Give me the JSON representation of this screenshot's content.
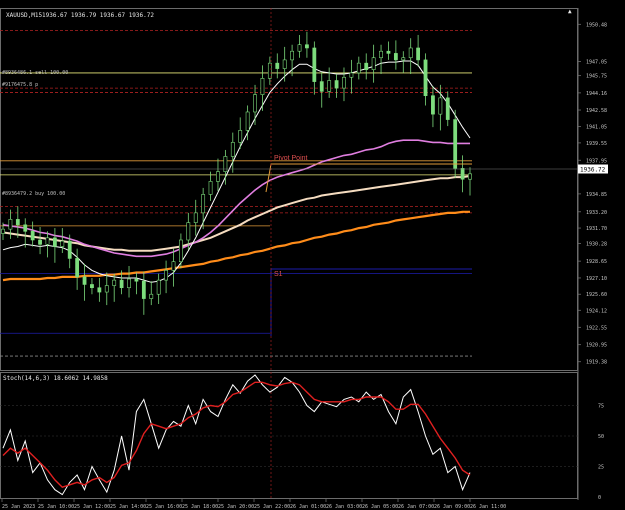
{
  "window": {
    "symbol_label": "XAUUSD,M15"
  },
  "header": {
    "ohlc": "1936.67 1936.79 1936.67 1936.72"
  },
  "levels": {
    "pivot_label": "Pivot Point",
    "s1_label": "S1",
    "order_lines": [
      "#8936486.1 sell 100.00",
      "#9176475.8 p",
      "#8936479.2 buy 100.00"
    ],
    "current_price_badge": "1936.72"
  },
  "indicator": {
    "label": "Stoch(14,6,3) 18.6062 14.9858"
  },
  "chart_data": [
    {
      "type": "line",
      "series_kind": "candlestick",
      "ylim": [
        1918.8,
        1951.8
      ],
      "y_ticks": [
        "1950.48",
        "1947.05",
        "1945.75",
        "1944.16",
        "1942.58",
        "1941.05",
        "1939.55",
        "1937.95",
        "1936.72",
        "1934.85",
        "1933.20",
        "1931.70",
        "1930.28",
        "1928.65",
        "1927.10",
        "1925.60",
        "1924.12",
        "1922.55",
        "1920.95",
        "1919.38"
      ],
      "x_ticks": [
        "25 Jan 2023",
        "25 Jan 10:00",
        "25 Jan 12:00",
        "25 Jan 14:00",
        "25 Jan 16:00",
        "25 Jan 18:00",
        "25 Jan 20:00",
        "25 Jan 22:00",
        "26 Jan 01:00",
        "26 Jan 03:00",
        "26 Jan 05:00",
        "26 Jan 07:00",
        "26 Jan 09:00",
        "26 Jan 11:00"
      ],
      "price_close": [
        1931.6,
        1932.5,
        1932.0,
        1931.4,
        1930.6,
        1930.2,
        1930.8,
        1930.0,
        1930.5,
        1928.9,
        1927.2,
        1926.5,
        1926.2,
        1925.8,
        1926.4,
        1926.9,
        1926.2,
        1927.0,
        1926.8,
        1925.2,
        1925.6,
        1926.9,
        1927.8,
        1928.6,
        1930.6,
        1932.2,
        1933.1,
        1934.8,
        1936.0,
        1936.9,
        1938.3,
        1939.6,
        1940.7,
        1942.4,
        1944.0,
        1945.5,
        1946.9,
        1946.4,
        1947.2,
        1948.0,
        1948.6,
        1948.3,
        1945.2,
        1944.3,
        1945.3,
        1944.6,
        1945.6,
        1946.0,
        1946.9,
        1946.3,
        1947.4,
        1948.0,
        1947.8,
        1947.2,
        1947.4,
        1948.3,
        1947.2,
        1943.9,
        1942.2,
        1943.7,
        1941.7,
        1937.2,
        1936.2,
        1936.7
      ],
      "ema_fast": [
        1929.7,
        1929.9,
        1930.0,
        1930.2,
        1930.1,
        1930.0,
        1930.1,
        1930.0,
        1929.9,
        1929.6,
        1929.0,
        1928.3,
        1927.8,
        1927.5,
        1927.3,
        1927.2,
        1927.1,
        1927.1,
        1927.1,
        1926.9,
        1926.7,
        1926.8,
        1927.1,
        1927.6,
        1928.5,
        1929.6,
        1930.8,
        1932.2,
        1933.6,
        1935.0,
        1936.4,
        1937.8,
        1939.2,
        1940.5,
        1941.8,
        1943.0,
        1944.2,
        1945.0,
        1945.7,
        1946.3,
        1946.8,
        1946.8,
        1946.4,
        1946.1,
        1946.0,
        1945.9,
        1945.9,
        1946.0,
        1946.2,
        1946.4,
        1946.6,
        1946.9,
        1947.0,
        1947.0,
        1947.1,
        1947.1,
        1946.7,
        1945.7,
        1944.7,
        1944.1,
        1943.2,
        1942.1,
        1941.0,
        1940.0
      ],
      "ema_mid": [
        1932.0,
        1931.9,
        1931.8,
        1931.7,
        1931.5,
        1931.3,
        1931.2,
        1931.0,
        1930.9,
        1930.7,
        1930.5,
        1930.2,
        1930.0,
        1929.8,
        1929.6,
        1929.4,
        1929.3,
        1929.2,
        1929.1,
        1929.1,
        1929.1,
        1929.2,
        1929.3,
        1929.5,
        1929.8,
        1930.1,
        1930.4,
        1930.8,
        1931.3,
        1931.9,
        1932.6,
        1933.3,
        1934.0,
        1934.6,
        1935.2,
        1935.7,
        1936.1,
        1936.4,
        1936.6,
        1936.8,
        1937.0,
        1937.2,
        1937.5,
        1937.8,
        1938.0,
        1938.2,
        1938.4,
        1938.5,
        1938.7,
        1938.9,
        1939.0,
        1939.2,
        1939.5,
        1939.7,
        1939.8,
        1939.8,
        1939.8,
        1939.7,
        1939.6,
        1939.6,
        1939.5,
        1939.5,
        1939.5,
        1939.5
      ],
      "ema_slow": [
        1931.3,
        1931.2,
        1931.1,
        1931.0,
        1930.9,
        1930.8,
        1930.7,
        1930.6,
        1930.5,
        1930.4,
        1930.3,
        1930.1,
        1930.0,
        1929.9,
        1929.8,
        1929.7,
        1929.7,
        1929.6,
        1929.6,
        1929.6,
        1929.6,
        1929.7,
        1929.8,
        1929.9,
        1930.0,
        1930.2,
        1930.4,
        1930.6,
        1930.8,
        1931.1,
        1931.4,
        1931.7,
        1932.0,
        1932.4,
        1932.7,
        1933.0,
        1933.3,
        1933.6,
        1933.8,
        1934.0,
        1934.2,
        1934.4,
        1934.5,
        1934.7,
        1934.8,
        1934.9,
        1935.0,
        1935.1,
        1935.2,
        1935.3,
        1935.4,
        1935.5,
        1935.6,
        1935.7,
        1935.8,
        1935.9,
        1936.0,
        1936.1,
        1936.2,
        1936.3,
        1936.3,
        1936.4,
        1936.4,
        1936.5
      ],
      "ema_long": [
        1926.9,
        1927.0,
        1927.0,
        1927.0,
        1927.0,
        1927.0,
        1927.1,
        1927.1,
        1927.2,
        1927.2,
        1927.2,
        1927.3,
        1927.3,
        1927.3,
        1927.4,
        1927.4,
        1927.5,
        1927.5,
        1927.6,
        1927.6,
        1927.7,
        1927.8,
        1927.9,
        1928.0,
        1928.1,
        1928.2,
        1928.3,
        1928.4,
        1928.6,
        1928.7,
        1928.9,
        1929.0,
        1929.2,
        1929.3,
        1929.5,
        1929.6,
        1929.8,
        1930.0,
        1930.1,
        1930.3,
        1930.4,
        1930.6,
        1930.8,
        1930.9,
        1931.1,
        1931.2,
        1931.4,
        1931.5,
        1931.7,
        1931.8,
        1932.0,
        1932.1,
        1932.2,
        1932.4,
        1932.5,
        1932.6,
        1932.7,
        1932.8,
        1932.9,
        1933.0,
        1933.1,
        1933.1,
        1933.2,
        1933.2
      ],
      "horizontal_levels": [
        {
          "price": 1949.9,
          "color": "#b22222"
        },
        {
          "price": 1946.0,
          "color": "#e8e87a"
        },
        {
          "price": 1944.6,
          "color": "#b22222"
        },
        {
          "price": 1944.2,
          "color": "#b22222"
        },
        {
          "price": 1936.6,
          "color": "#e8e87a"
        },
        {
          "price": 1937.9,
          "color": "#e09a3a"
        },
        {
          "price": 1933.7,
          "color": "#b22222"
        },
        {
          "price": 1933.1,
          "color": "#b22222"
        },
        {
          "price": 1931.9,
          "color": "#e09a3a"
        },
        {
          "price": 1927.5,
          "color": "#1c1caa"
        },
        {
          "price": 1922.0,
          "color": "#1c1caa"
        },
        {
          "price": 1919.9,
          "color": "#888888"
        }
      ],
      "colors": {
        "candle": "#7ddc7d",
        "ema_fast": "#ffffff",
        "ema_mid": "#e07ee0",
        "ema_slow": "#f5dcc0",
        "ema_long": "#ff8c1a",
        "price_line": "#c8c8c8"
      }
    },
    {
      "type": "line",
      "title": "Stoch(14,6,3) 18.6062 14.9858",
      "ylim": [
        0,
        100
      ],
      "y_ticks": [
        "75",
        "50",
        "25",
        "0"
      ],
      "series": [
        {
          "name": "main",
          "values": [
            40,
            55,
            30,
            46,
            20,
            28,
            14,
            6,
            2,
            12,
            18,
            6,
            25,
            14,
            4,
            22,
            50,
            22,
            70,
            80,
            60,
            40,
            55,
            62,
            58,
            75,
            60,
            80,
            70,
            66,
            80,
            92,
            85,
            95,
            100,
            92,
            86,
            90,
            98,
            94,
            86,
            75,
            70,
            78,
            76,
            74,
            80,
            82,
            78,
            86,
            80,
            84,
            70,
            60,
            82,
            88,
            70,
            50,
            35,
            40,
            20,
            25,
            6,
            20
          ]
        },
        {
          "name": "signal",
          "values": [
            34,
            40,
            36,
            40,
            34,
            28,
            22,
            14,
            8,
            10,
            12,
            10,
            14,
            16,
            12,
            16,
            26,
            28,
            38,
            52,
            60,
            58,
            56,
            58,
            60,
            65,
            68,
            73,
            75,
            74,
            78,
            84,
            86,
            90,
            94,
            94,
            92,
            91,
            93,
            94,
            92,
            86,
            80,
            78,
            78,
            78,
            78,
            80,
            80,
            82,
            82,
            82,
            78,
            72,
            72,
            76,
            76,
            68,
            58,
            48,
            40,
            32,
            22,
            18
          ]
        }
      ],
      "colors": {
        "main": "#ffffff",
        "signal": "#e02020"
      }
    }
  ]
}
